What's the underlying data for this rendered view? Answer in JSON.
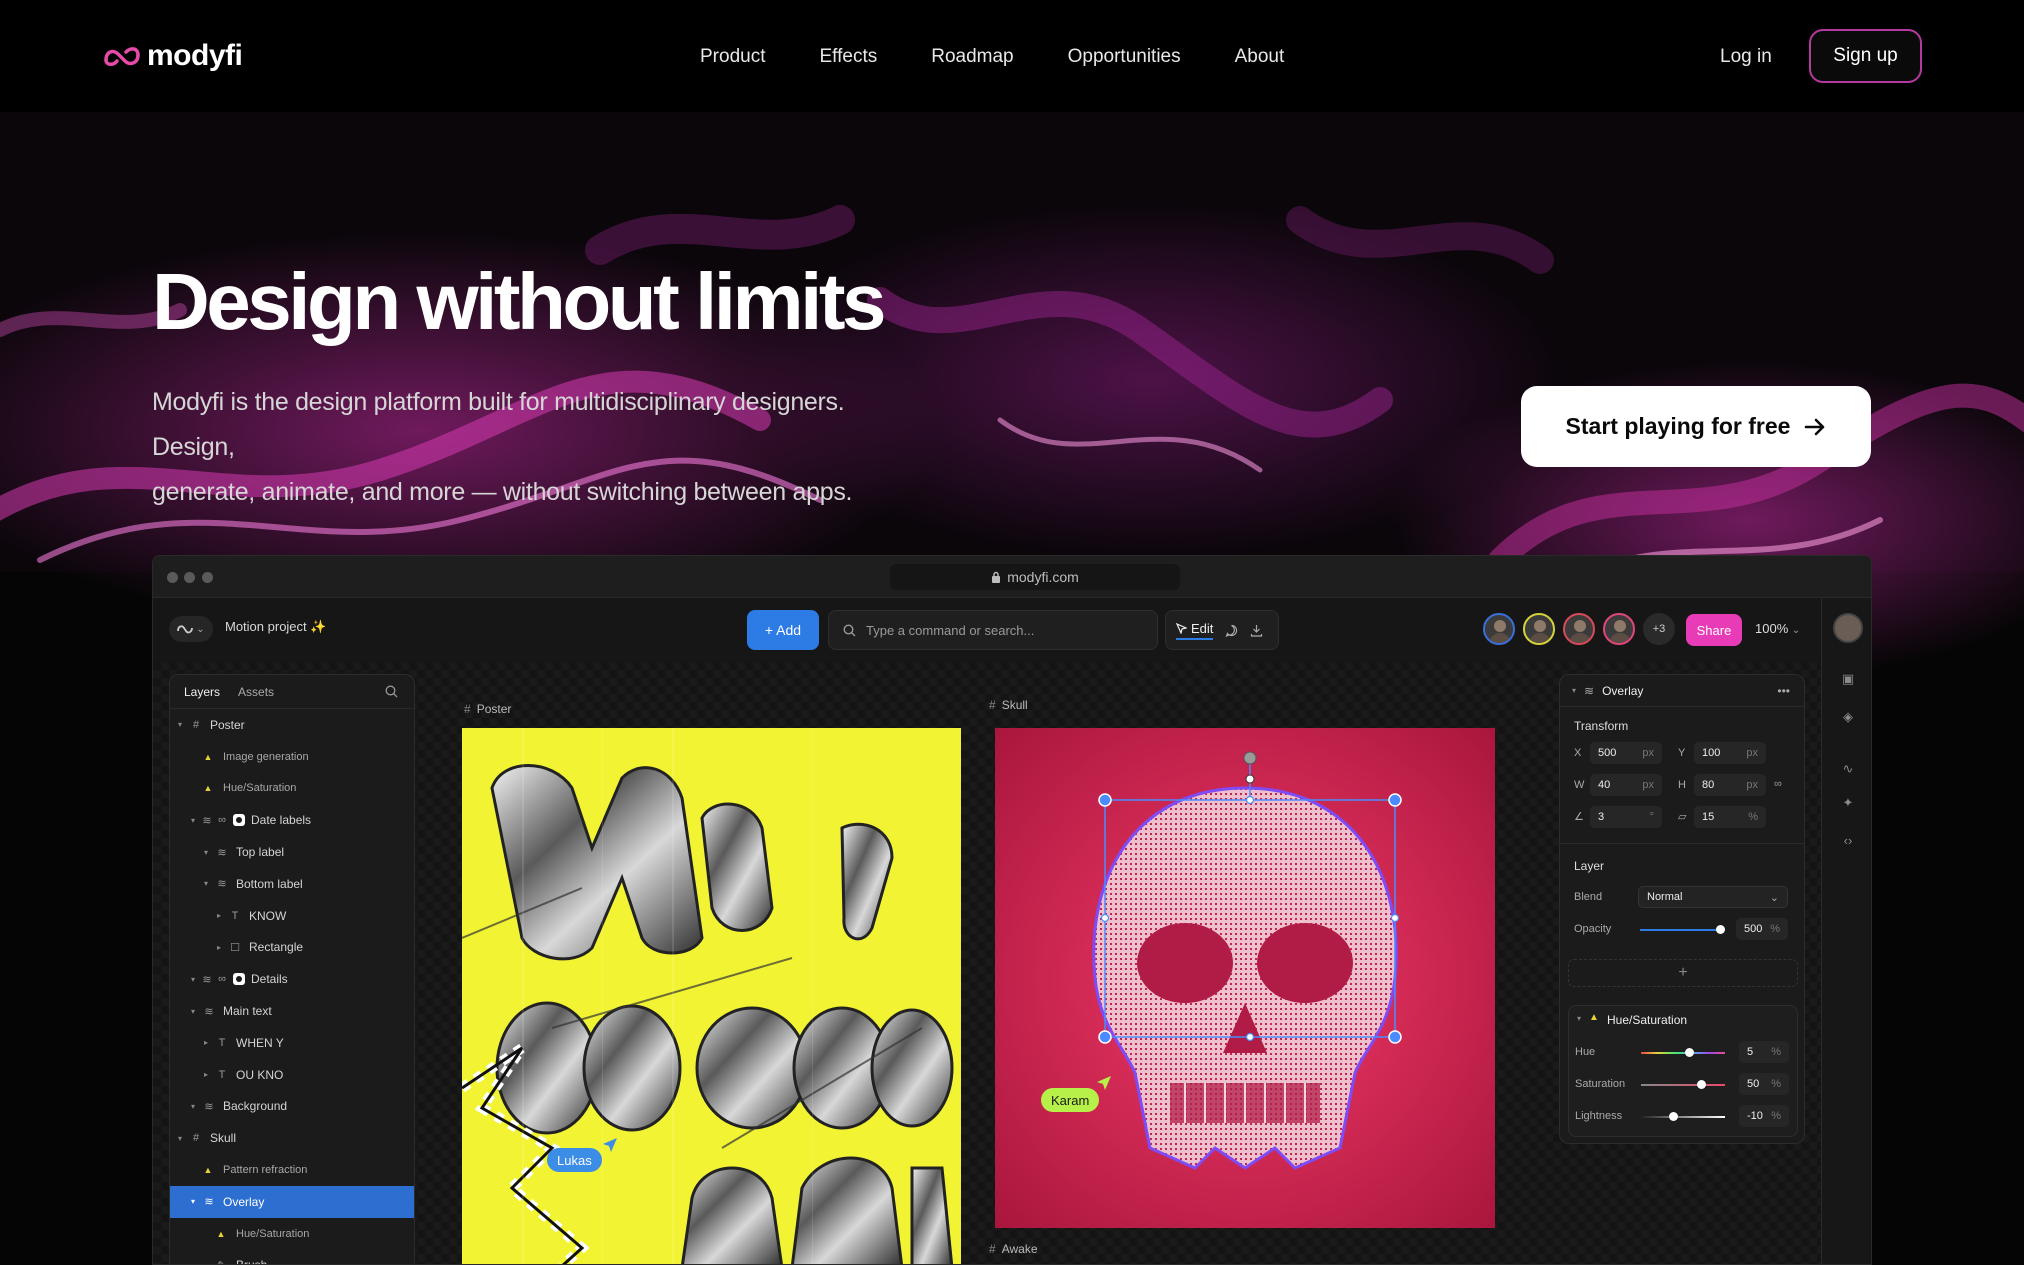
{
  "nav": {
    "logo_text": "modyfi",
    "links": [
      "Product",
      "Effects",
      "Roadmap",
      "Opportunities",
      "About"
    ],
    "login": "Log in",
    "signup": "Sign up"
  },
  "hero": {
    "title": "Design without limits",
    "subtitle_line1": "Modyfi is the design platform built for multidisciplinary designers. Design,",
    "subtitle_line2": "generate, animate, and more — without switching between apps.",
    "cta": "Start playing for free"
  },
  "app": {
    "url": "modyfi.com",
    "project_name": "Motion project ✨",
    "add_label": "+ Add",
    "command_placeholder": "Type a command or search...",
    "edit_label": "Edit",
    "more_collaborators": "+3",
    "share_label": "Share",
    "zoom": "100%",
    "layers_panel": {
      "tab_layers": "Layers",
      "tab_assets": "Assets",
      "rows": [
        {
          "label": "Poster",
          "indent": 0,
          "kind": "frame"
        },
        {
          "label": "Image generation",
          "indent": 1,
          "kind": "fx"
        },
        {
          "label": "Hue/Saturation",
          "indent": 1,
          "kind": "fx"
        },
        {
          "label": "Date labels",
          "indent": 1,
          "kind": "group-o"
        },
        {
          "label": "Top label",
          "indent": 2,
          "kind": "group"
        },
        {
          "label": "Bottom label",
          "indent": 2,
          "kind": "group"
        },
        {
          "label": "KNOW",
          "indent": 3,
          "kind": "text"
        },
        {
          "label": "Rectangle",
          "indent": 3,
          "kind": "rect"
        },
        {
          "label": "Details",
          "indent": 1,
          "kind": "group-o"
        },
        {
          "label": "Main text",
          "indent": 1,
          "kind": "group"
        },
        {
          "label": "WHEN Y",
          "indent": 2,
          "kind": "text"
        },
        {
          "label": "OU KNO",
          "indent": 2,
          "kind": "text"
        },
        {
          "label": "Background",
          "indent": 1,
          "kind": "group"
        },
        {
          "label": "Skull",
          "indent": 0,
          "kind": "frame"
        },
        {
          "label": "Pattern refraction",
          "indent": 1,
          "kind": "fx"
        },
        {
          "label": "Overlay",
          "indent": 1,
          "kind": "group",
          "selected": true
        },
        {
          "label": "Hue/Saturation",
          "indent": 2,
          "kind": "fx"
        },
        {
          "label": "Brush",
          "indent": 2,
          "kind": "brush"
        }
      ]
    },
    "frames": {
      "poster_label": "Poster",
      "skull_label": "Skull",
      "awake_label": "Awake"
    },
    "cursors": {
      "lukas": "Lukas",
      "karam": "Karam"
    },
    "properties": {
      "layer_name": "Overlay",
      "transform_title": "Transform",
      "x_label": "X",
      "x_value": "500",
      "x_unit": "px",
      "y_label": "Y",
      "y_value": "100",
      "y_unit": "px",
      "w_label": "W",
      "w_value": "40",
      "w_unit": "px",
      "h_label": "H",
      "h_value": "80",
      "h_unit": "px",
      "rotation_value": "3",
      "rotation_unit": "°",
      "skew_value": "15",
      "skew_unit": "%",
      "layer_title": "Layer",
      "blend_label": "Blend",
      "blend_value": "Normal",
      "opacity_label": "Opacity",
      "opacity_value": "500",
      "opacity_unit": "%",
      "hue_sat_title": "Hue/Saturation",
      "hue_label": "Hue",
      "hue_value": "5",
      "hue_unit": "%",
      "saturation_label": "Saturation",
      "saturation_value": "50",
      "saturation_unit": "%",
      "lightness_label": "Lightness",
      "lightness_value": "-10",
      "lightness_unit": "%"
    }
  },
  "colors": {
    "accent_blue": "#2d7be5",
    "share_pink": "#e83bb8",
    "signup_border": "#b23aa0",
    "poster_yellow": "#f2f433",
    "skull_red": "#d22a55"
  }
}
